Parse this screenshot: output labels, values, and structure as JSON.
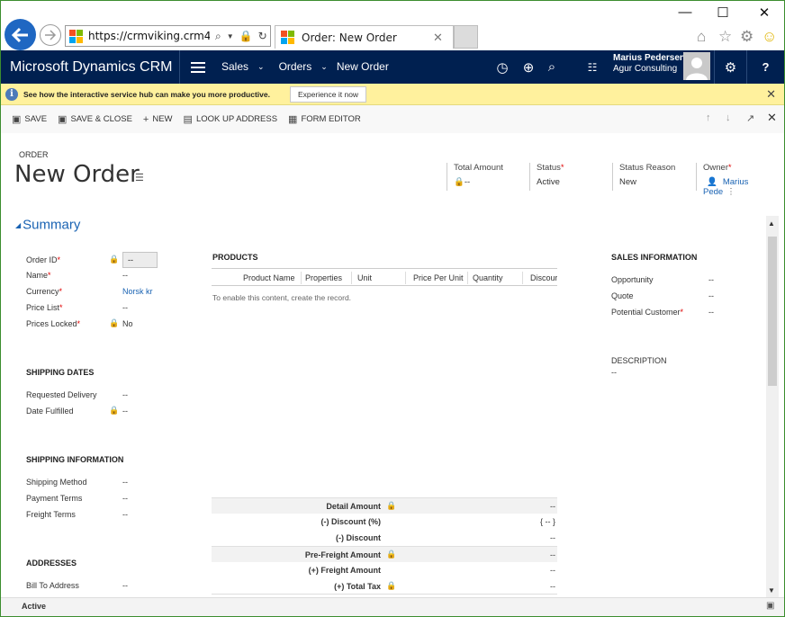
{
  "browser": {
    "url": "https://crmviking.crm4.d",
    "tab_title": "Order: New Order",
    "tab_close": "✕",
    "window_controls": {
      "minimize": "—",
      "maximize": "☐",
      "close": "✕"
    }
  },
  "nav": {
    "brand": "Microsoft Dynamics CRM",
    "area": "Sales",
    "entity": "Orders",
    "record": "New Order",
    "user_name": "Marius Pedersen",
    "user_org": "Agur Consulting",
    "help": "?"
  },
  "notification": {
    "text": "See how the interactive service hub can make you more productive.",
    "button": "Experience it now"
  },
  "commands": {
    "save": "SAVE",
    "save_close": "SAVE & CLOSE",
    "new": "NEW",
    "lookup": "LOOK UP ADDRESS",
    "form_editor": "FORM EDITOR"
  },
  "header": {
    "entity": "ORDER",
    "title": "New Order",
    "total_amount_label": "Total Amount",
    "total_amount_value": "--",
    "status_label": "Status",
    "status_value": "Active",
    "status_reason_label": "Status Reason",
    "status_reason_value": "New",
    "owner_label": "Owner",
    "owner_value": "Marius Pede"
  },
  "summary": {
    "title": "Summary",
    "order_id_label": "Order ID",
    "order_id_value": "--",
    "name_label": "Name",
    "name_value": "--",
    "currency_label": "Currency",
    "currency_value": "Norsk kr",
    "price_list_label": "Price List",
    "price_list_value": "--",
    "prices_locked_label": "Prices Locked",
    "prices_locked_value": "No"
  },
  "shipping_dates": {
    "title": "SHIPPING DATES",
    "requested_label": "Requested Delivery",
    "requested_value": "--",
    "fulfilled_label": "Date Fulfilled",
    "fulfilled_value": "--"
  },
  "shipping_info": {
    "title": "SHIPPING INFORMATION",
    "method_label": "Shipping Method",
    "method_value": "--",
    "payment_label": "Payment Terms",
    "payment_value": "--",
    "freight_label": "Freight Terms",
    "freight_value": "--"
  },
  "addresses": {
    "title": "ADDRESSES",
    "bill_label": "Bill To Address",
    "bill_value": "--"
  },
  "products": {
    "title": "PRODUCTS",
    "columns": [
      "Product Name",
      "Properties",
      "Unit",
      "Price Per Unit",
      "Quantity",
      "Discour"
    ],
    "message": "To enable this content, create the record."
  },
  "totals": {
    "detail_amount_label": "Detail Amount",
    "detail_amount_value": "--",
    "discount_pct_label": "(-) Discount (%)",
    "discount_pct_value": "{ -- }",
    "discount_label": "(-) Discount",
    "discount_value": "--",
    "pre_freight_label": "Pre-Freight Amount",
    "pre_freight_value": "--",
    "freight_label": "(+) Freight Amount",
    "freight_value": "--",
    "tax_label": "(+) Total Tax",
    "tax_value": "--"
  },
  "sales_info": {
    "title": "SALES INFORMATION",
    "opportunity_label": "Opportunity",
    "opportunity_value": "--",
    "quote_label": "Quote",
    "quote_value": "--",
    "customer_label": "Potential Customer",
    "customer_value": "--",
    "description_label": "DESCRIPTION",
    "description_value": "--"
  },
  "status_bar": {
    "text": "Active"
  },
  "colors": {
    "nav_bg": "#002050",
    "notif_bg": "#fff19d",
    "link": "#1a63b3",
    "required": "#e00000"
  }
}
